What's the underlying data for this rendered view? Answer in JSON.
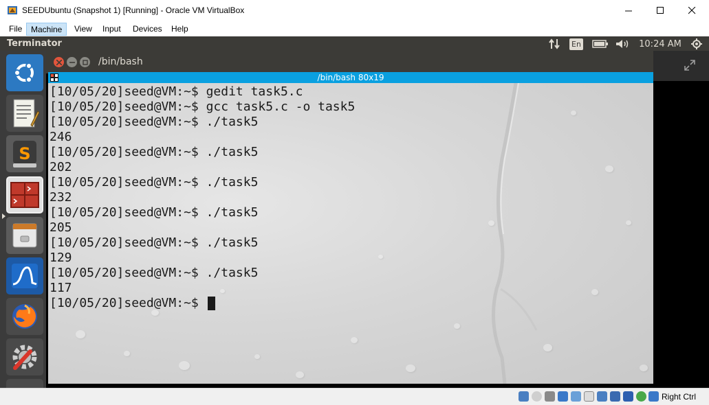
{
  "host": {
    "title": "SEEDUbuntu (Snapshot 1) [Running] - Oracle VM VirtualBox",
    "menu": [
      "File",
      "Machine",
      "View",
      "Input",
      "Devices",
      "Help"
    ],
    "active_menu": "Machine",
    "host_key": "Right Ctrl"
  },
  "guest": {
    "topbar_title": "Terminator",
    "keyboard_layout": "En",
    "clock": "10:24 AM",
    "window_title": "/bin/bash",
    "tab_title": "/bin/bash 80x19",
    "launcher_items": [
      "ubuntu-dash-icon",
      "text-editor-icon",
      "sublime-text-icon",
      "terminator-icon",
      "file-manager-icon",
      "wireshark-icon",
      "firefox-icon",
      "system-settings-icon",
      "partial-launcher-icon"
    ]
  },
  "terminal": {
    "lines": [
      "[10/05/20]seed@VM:~$ gedit task5.c",
      "[10/05/20]seed@VM:~$ gcc task5.c -o task5",
      "[10/05/20]seed@VM:~$ ./task5",
      "246",
      "[10/05/20]seed@VM:~$ ./task5",
      "202",
      "[10/05/20]seed@VM:~$ ./task5",
      "232",
      "[10/05/20]seed@VM:~$ ./task5",
      "205",
      "[10/05/20]seed@VM:~$ ./task5",
      "129",
      "[10/05/20]seed@VM:~$ ./task5",
      "117"
    ],
    "prompt": "[10/05/20]seed@VM:~$ "
  },
  "colors": {
    "tab_bar": "#0aa0e0",
    "unity_panel": "#3c3b37",
    "launcher": "#3b3b3b",
    "close_button": "#e2553c"
  }
}
